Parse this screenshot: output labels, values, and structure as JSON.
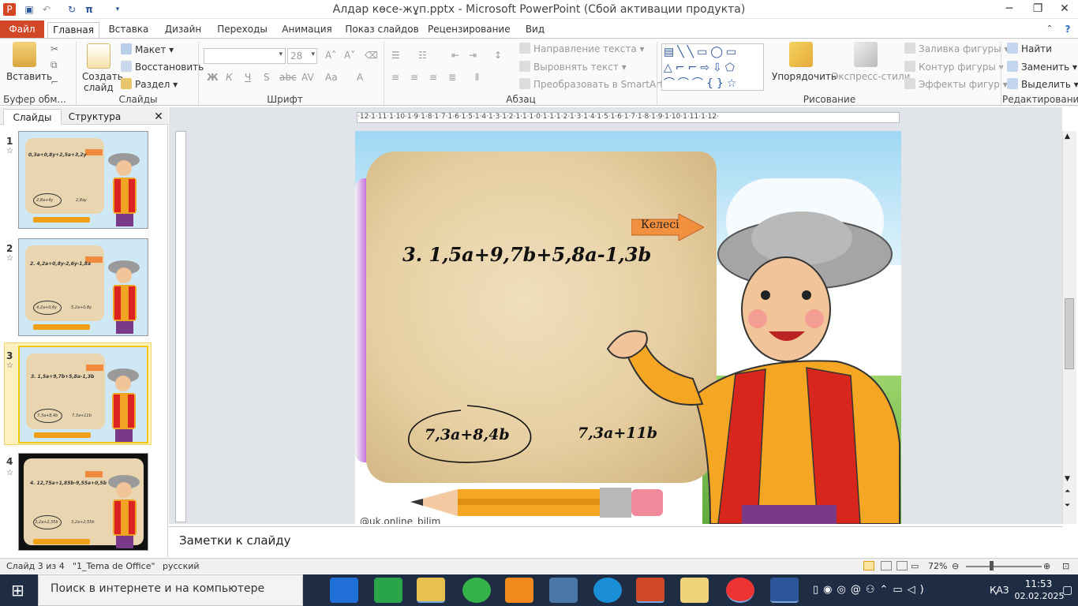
{
  "window": {
    "title": "Алдар көсе-жұп.pptx - Microsoft PowerPoint (Сбой активации продукта)"
  },
  "tabs": [
    "Файл",
    "Главная",
    "Вставка",
    "Дизайн",
    "Переходы",
    "Анимация",
    "Показ слайдов",
    "Рецензирование",
    "Вид"
  ],
  "ribbon": {
    "clipboard": {
      "paste": "Вставить",
      "label": "Буфер обм..."
    },
    "slides": {
      "create": "Создать",
      "create2": "слайд",
      "layout": "Макет",
      "reset": "Восстановить",
      "section": "Раздел",
      "label": "Слайды"
    },
    "font": {
      "size": "28",
      "bold": "Ж",
      "italic": "К",
      "underline": "Ч",
      "strike": "S",
      "abc": "abc",
      "spacing": "AV",
      "case": "Aa",
      "color": "A",
      "label": "Шрифт"
    },
    "paragraph": {
      "text_dir": "Направление текста",
      "align_text": "Выровнять текст",
      "smartart": "Преобразовать в SmartArt",
      "label": "Абзац"
    },
    "drawing": {
      "arrange": "Упорядочить",
      "quick_styles": "Экспресс-стили",
      "fill": "Заливка фигуры",
      "outline": "Контур фигуры",
      "effects": "Эффекты фигур",
      "label": "Рисование"
    },
    "editing": {
      "find": "Найти",
      "replace": "Заменить",
      "select": "Выделить",
      "label": "Редактирование"
    }
  },
  "left_pane": {
    "tabs": [
      "Слайды",
      "Структура"
    ],
    "thumbs": [
      {
        "num": "1",
        "eq": "0,3a+0,8y+2,5a+3,2y",
        "a1": "2,8a+4y",
        "a2": "2,8ay"
      },
      {
        "num": "2",
        "eq": "2. 4,2a+0,8y-2,6y-1,8a",
        "a1": "4,2a+0,6y",
        "a2": "5,2a+0,8y"
      },
      {
        "num": "3",
        "eq": "3. 1,5a+9,7b+5,8a-1,3b",
        "a1": "7,3a+8,4b",
        "a2": "7,3a+11b"
      },
      {
        "num": "4",
        "eq": "4. 12,75a+1,85b-9,55a+0,5b",
        "a1": "3,2a+2,35b",
        "a2": "3,2a+2,55b"
      }
    ]
  },
  "ruler": {
    "h": "·12·1·11·1·10·1·9·1·8·1·7·1·6·1·5·1·4·1·3·1·2·1·1·1·0·1·1·1·2·1·3·1·4·1·5·1·6·1·7·1·8·1·9·1·10·1·11·1·12·"
  },
  "slide": {
    "next": "Келесі",
    "problem": "3. 1,5a+9,7b+5,8a-1,3b",
    "answer1": "7,3a+8,4b",
    "answer2": "7,3a+11b",
    "watermark": "@uk.online_bilim"
  },
  "notes": {
    "placeholder": "Заметки к слайду"
  },
  "status": {
    "slide": "Слайд 3 из 4",
    "theme": "\"1_Tema de Office\"",
    "lang": "русский",
    "zoom": "72%"
  },
  "taskbar": {
    "search": "Поиск в интернете и на компьютере",
    "lang": "ҚАЗ",
    "time": "11:53",
    "date": "02.02.2025"
  },
  "colors": {
    "accent": "#d24726",
    "taskbar": "#1f2d44",
    "selection": "#f2c811"
  }
}
